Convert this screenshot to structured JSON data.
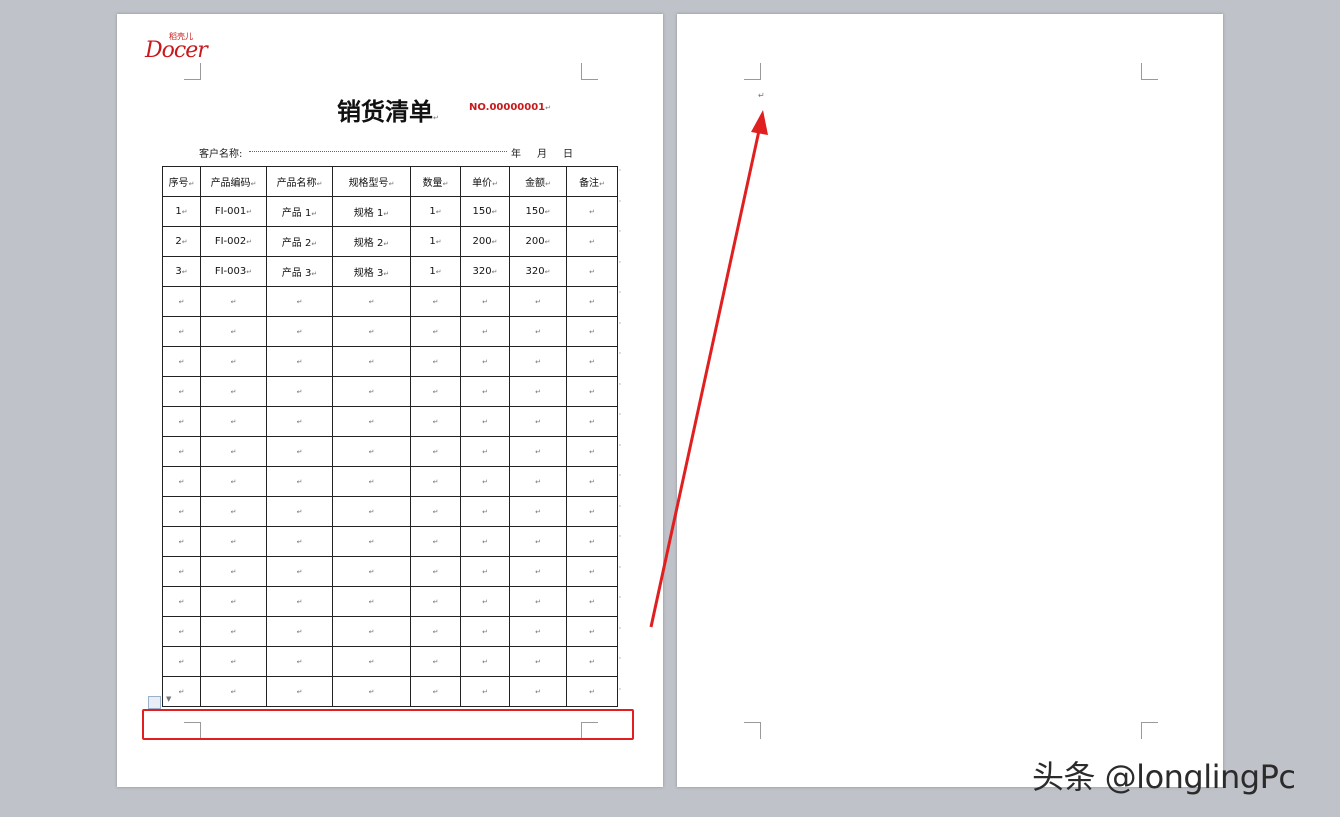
{
  "app": {
    "view": "WPS Writer two-page print layout",
    "watermark": "头条 @longlingPc"
  },
  "page1": {
    "logo": {
      "small": "稻壳儿",
      "main": "Docer"
    },
    "title": "销货清单",
    "doc_no": "NO.00000001",
    "customer_label": "客户名称:",
    "date_labels": [
      "年",
      "月",
      "日"
    ],
    "para_mark": "↵",
    "table": {
      "headers": [
        "序号",
        "产品编码",
        "产品名称",
        "规格型号",
        "数量",
        "单价",
        "金额",
        "备注"
      ],
      "rows": [
        [
          "1",
          "FI-001",
          "产品 1",
          "规格 1",
          "1",
          "150",
          "150",
          ""
        ],
        [
          "2",
          "FI-002",
          "产品 2",
          "规格 2",
          "1",
          "200",
          "200",
          ""
        ],
        [
          "3",
          "FI-003",
          "产品 3",
          "规格 3",
          "1",
          "320",
          "320",
          ""
        ]
      ],
      "empty_rows": 14
    }
  },
  "page2": {
    "para_mark": "↵"
  },
  "colors": {
    "brand_red": "#c8191c",
    "annotation_red": "#e02020",
    "canvas_gray": "#bfc2c9"
  }
}
